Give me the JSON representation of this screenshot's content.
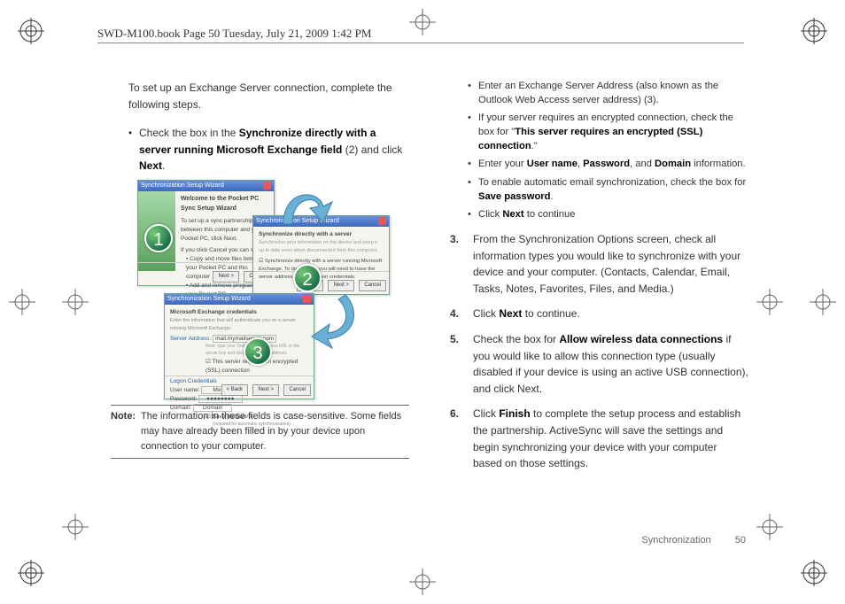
{
  "header": {
    "text": "SWD-M100.book  Page 50  Tuesday, July 21, 2009  1:42 PM"
  },
  "left": {
    "intro": "To set up an Exchange Server connection, complete the following steps.",
    "bullet1_a": "Check the box in the ",
    "bullet1_b": "Synchronize directly with a server running Microsoft Exchange field",
    "bullet1_c": " (2) and click ",
    "bullet1_d": "Next",
    "bullet1_e": ".",
    "note_label": "Note:",
    "note_text": "The information in these fields is case-sensitive. Some fields may have already been filled in by your device upon connection to your computer."
  },
  "figure": {
    "win1_title": "Synchronization Setup Wizard",
    "win1_h": "Welcome to the Pocket PC Sync Setup Wizard",
    "win1_p1": "To set up a sync partnership between this computer and your Pocket PC, click Next.",
    "win1_p2": "If you click Cancel you can still:",
    "win1_li1": "Copy and move files between your Pocket PC and this computer",
    "win1_li2": "Add and remove programs on your Pocket PC",
    "win2_title": "Synchronization Setup Wizard",
    "win2_h": "Synchronize directly with a server",
    "win2_p": "Synchronize your information on the device and keep it up to date even when disconnected from this computer.",
    "win2_chk": "Synchronize directly with a server running Microsoft Exchange.  To do this now you will need to have the server address and your logon credentials.",
    "win3_title": "Synchronization Setup Wizard",
    "win3_h": "Microsoft Exchange credentials",
    "win3_sub": "Enter the information that will authenticate you on a server running Microsoft Exchange.",
    "win3_sa_lbl": "Server Address:",
    "win3_sa_val": "mail.mymailserver.com",
    "win3_sa_note": "Note: type your Outlook Web Access URL in the server box and click OK to verify address.",
    "win3_ssl": "This server requires an encrypted (SSL) connection",
    "win3_lc": "Logon Credentials",
    "win3_un_lbl": "User name:",
    "win3_un_val": "Me",
    "win3_pw_lbl": "Password:",
    "win3_pw_val": "●●●●●●●●",
    "win3_dm_lbl": "Domain:",
    "win3_dm_val": "Domain",
    "win3_save": "Save password",
    "win3_req": "(required for automatic synchronization)",
    "btn_back": "< Back",
    "btn_next": "Next >",
    "btn_cancel": "Cancel",
    "badge1": "1",
    "badge2": "2",
    "badge3": "3"
  },
  "right": {
    "sb1_a": "Enter an Exchange Server Address (also known as the Outlook Web Access server address) (3).",
    "sb2_a": "If your server requires an encrypted connection, check the box for \"",
    "sb2_b": "This server requires an encrypted (SSL) connection",
    "sb2_c": ".\"",
    "sb3_a": "Enter your ",
    "sb3_b": "User name",
    "sb3_c": ", ",
    "sb3_d": "Password",
    "sb3_e": ", and ",
    "sb3_f": "Domain",
    "sb3_g": " information.",
    "sb4_a": "To enable automatic email synchronization, check the box for ",
    "sb4_b": "Save password",
    "sb4_c": ".",
    "sb5_a": "Click ",
    "sb5_b": "Next",
    "sb5_c": " to continue",
    "step3_num": "3.",
    "step3": "From the Synchronization Options screen, check all information types you would like to synchronize with your device and your computer. (Contacts, Calendar, Email, Tasks, Notes, Favorites, Files, and Media.)",
    "step4_num": "4.",
    "step4_a": "Click ",
    "step4_b": "Next",
    "step4_c": " to continue.",
    "step5_num": "5.",
    "step5_a": "Check the box for ",
    "step5_b": "Allow wireless data connections",
    "step5_c": " if you would like to allow this connection type (usually disabled if your device is using an active USB connection), and click Next.",
    "step6_num": "6.",
    "step6_a": "Click ",
    "step6_b": "Finish",
    "step6_c": " to complete the setup process and establish the partnership. ActiveSync will save the settings and begin synchronizing your device with your computer based on those settings."
  },
  "footer": {
    "section": "Synchronization",
    "page": "50"
  }
}
